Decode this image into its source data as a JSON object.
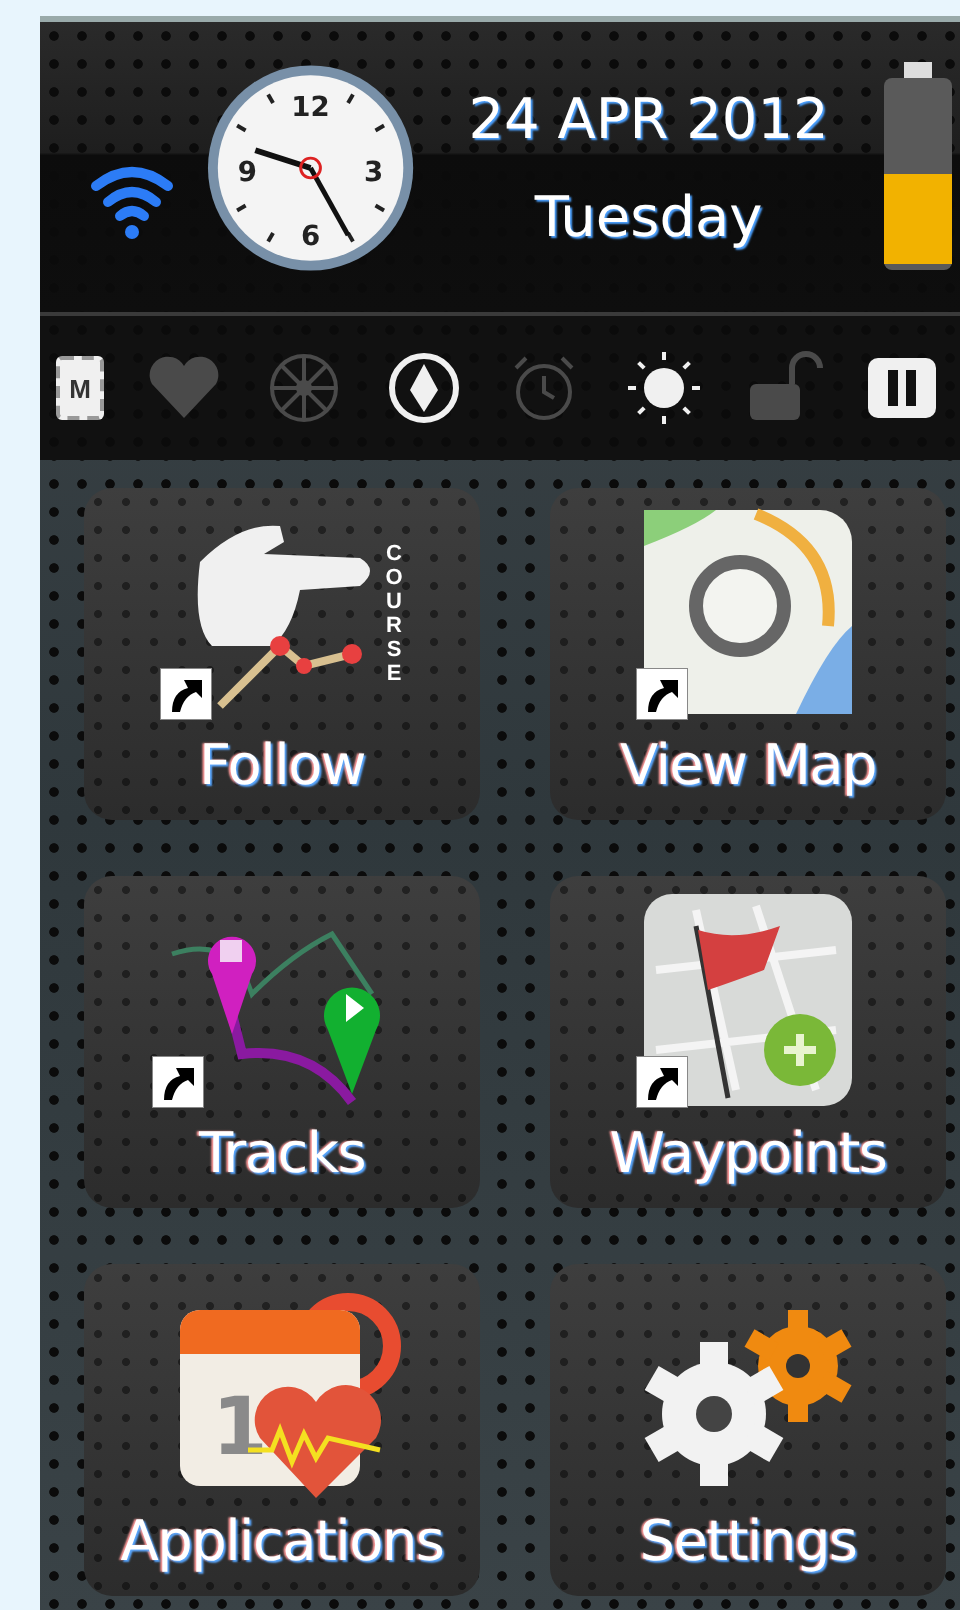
{
  "status_bar": {
    "clock": {
      "numerals": [
        "12",
        "3",
        "6",
        "9"
      ]
    },
    "date": "24 APR 2012",
    "weekday": "Tuesday",
    "battery": {
      "level": 0.5
    }
  },
  "indicators": [
    {
      "kind": "memory",
      "label": "M",
      "on": true
    },
    {
      "kind": "heart",
      "on": false
    },
    {
      "kind": "wheel",
      "on": false
    },
    {
      "kind": "compass",
      "on": true
    },
    {
      "kind": "alarm",
      "on": false
    },
    {
      "kind": "sun",
      "on": true
    },
    {
      "kind": "lock",
      "on": false
    },
    {
      "kind": "pause",
      "on": true
    }
  ],
  "tiles": [
    {
      "kind": "follow",
      "label": "Follow",
      "icon_text": "COURSE",
      "shortcut": true
    },
    {
      "kind": "map",
      "label": "View Map",
      "shortcut": true
    },
    {
      "kind": "tracks",
      "label": "Tracks",
      "shortcut": true
    },
    {
      "kind": "waypoints",
      "label": "Waypoints",
      "shortcut": true
    },
    {
      "kind": "applications",
      "label": "Applications",
      "icon_text": "1",
      "shortcut": false
    },
    {
      "kind": "settings",
      "label": "Settings",
      "shortcut": false
    }
  ]
}
